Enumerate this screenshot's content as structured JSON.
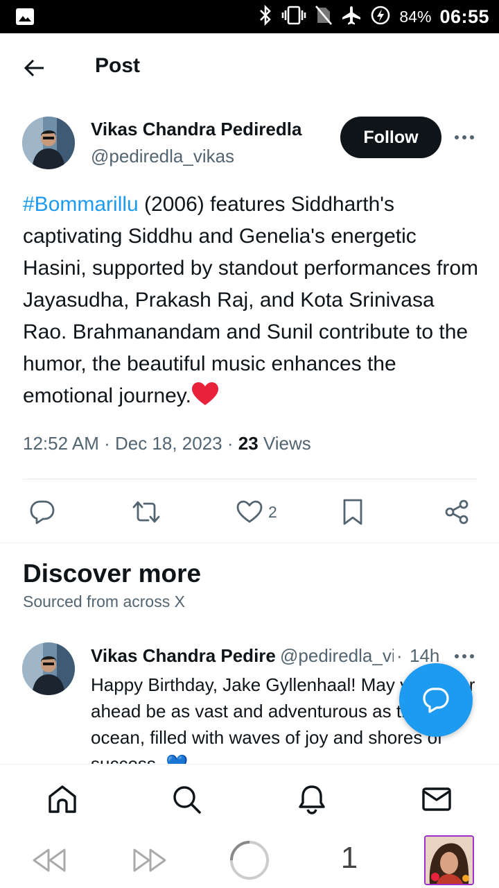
{
  "status_bar": {
    "battery": "84%",
    "time": "06:55",
    "icons": [
      "image-icon",
      "bluetooth-icon",
      "vibrate-icon",
      "no-sim-icon",
      "airplane-icon",
      "battery-saver-icon"
    ]
  },
  "header": {
    "title": "Post",
    "back_icon": "arrow-left-icon"
  },
  "post": {
    "author_name": "Vikas Chandra Pediredla",
    "author_handle": "@pediredla_vikas",
    "follow_label": "Follow",
    "hashtag": "#Bommarillu",
    "text": " (2006) features Siddharth's captivating Siddhu and Genelia's energetic Hasini, supported by standout performances from Jayasudha, Prakash Raj, and Kota Srinivasa Rao. Brahmanandam and Sunil contribute to the humor, the beautiful music enhances the emotional journey.",
    "time": "12:52 AM",
    "sep1": " · ",
    "date": "Dec 18, 2023",
    "sep2": " · ",
    "views_count": "23",
    "views_label": " Views",
    "likes_count": "2"
  },
  "discover": {
    "title": "Discover more",
    "subtitle": "Sourced from across X"
  },
  "feed_item": {
    "author_name": "Vikas Chandra Pediredla",
    "author_handle": "@pediredla_vikas",
    "dot": "·",
    "time": "14h",
    "text": "Happy Birthday, Jake Gyllenhaal! May your year ahead be as vast and adventurous as the ocean, filled with waves of joy and shores of success. 💙"
  },
  "media_bar": {
    "count": "1"
  },
  "colors": {
    "accent": "#1d9bf0",
    "text": "#0f1419",
    "secondary": "#536471",
    "heart": "#e8223b"
  }
}
